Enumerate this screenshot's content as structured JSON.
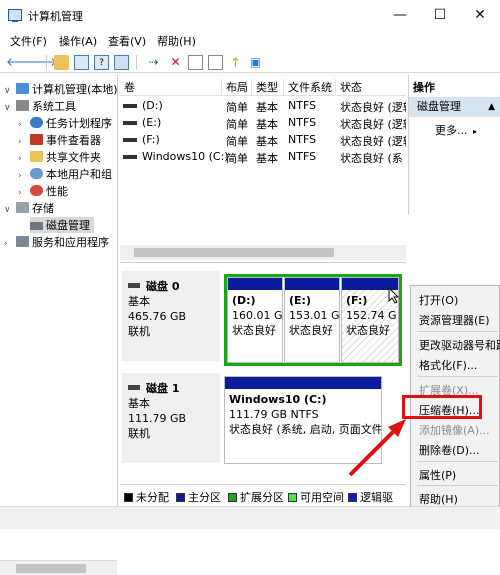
{
  "window": {
    "title": "计算机管理",
    "min": "—",
    "max": "☐",
    "close": "✕"
  },
  "menu": [
    "文件(F)",
    "操作(A)",
    "查看(V)",
    "帮助(H)"
  ],
  "toolbar": {
    "back": "🡐",
    "forward": "🡒",
    "icons": [
      "folder-icon",
      "properties-icon",
      "help-icon",
      "view-icon",
      "connect-icon",
      "delete-icon",
      "check-icon",
      "document-icon",
      "up-icon",
      "down-icon",
      "list-icon"
    ],
    "delete_glyph": "✕"
  },
  "tree": {
    "root": "计算机管理(本地)",
    "system_tools": "系统工具",
    "task_scheduler": "任务计划程序",
    "event_viewer": "事件查看器",
    "shared_folders": "共享文件夹",
    "local_users": "本地用户和组",
    "performance": "性能",
    "storage": "存储",
    "disk_management": "磁盘管理",
    "services": "服务和应用程序"
  },
  "volume_table": {
    "headers": [
      "卷",
      "布局",
      "类型",
      "文件系统",
      "状态"
    ],
    "rows": [
      {
        "vol": "(D:)",
        "layout": "简单",
        "type": "基本",
        "fs": "NTFS",
        "status": "状态良好 (逻辑"
      },
      {
        "vol": "(E:)",
        "layout": "简单",
        "type": "基本",
        "fs": "NTFS",
        "status": "状态良好 (逻辑"
      },
      {
        "vol": "(F:)",
        "layout": "简单",
        "type": "基本",
        "fs": "NTFS",
        "status": "状态良好 (逻辑"
      },
      {
        "vol": "Windows10 (C:)",
        "layout": "简单",
        "type": "基本",
        "fs": "NTFS",
        "status": "状态良好 (系"
      }
    ]
  },
  "disks": [
    {
      "name": "磁盘 0",
      "type": "基本",
      "size": "465.76 GB",
      "state": "联机",
      "parts": [
        {
          "label": "(D:)",
          "size": "160.01 G",
          "status": "状态良好"
        },
        {
          "label": "(E:)",
          "size": "153.01 G",
          "status": "状态良好"
        },
        {
          "label": "(F:)",
          "size": "152.74 G",
          "status": "状态良好"
        }
      ]
    },
    {
      "name": "磁盘 1",
      "type": "基本",
      "size": "111.79 GB",
      "state": "联机",
      "parts": [
        {
          "label": "Windows10 (C:)",
          "size": "111.79 GB NTFS",
          "status": "状态良好 (系统, 启动, 页面文件"
        }
      ]
    }
  ],
  "legend": [
    {
      "label": "未分配",
      "color": "#000000"
    },
    {
      "label": "主分区",
      "color": "#0a1b9c"
    },
    {
      "label": "扩展分区",
      "color": "#1aa61a"
    },
    {
      "label": "可用空间",
      "color": "#4be24b"
    },
    {
      "label": "逻辑驱",
      "color": "#0b20c4"
    }
  ],
  "actions": {
    "header": "操作",
    "section": "磁盘管理",
    "more": "更多..."
  },
  "context_menu": [
    {
      "label": "打开(O)",
      "enabled": true
    },
    {
      "label": "资源管理器(E)",
      "enabled": true
    },
    {
      "label": "更改驱动器号和路",
      "enabled": true
    },
    {
      "label": "格式化(F)...",
      "enabled": true
    },
    {
      "label": "扩展卷(X)...",
      "enabled": false
    },
    {
      "label": "压缩卷(H)...",
      "enabled": true
    },
    {
      "label": "添加镜像(A)...",
      "enabled": false
    },
    {
      "label": "删除卷(D)...",
      "enabled": true
    },
    {
      "label": "属性(P)",
      "enabled": true
    },
    {
      "label": "帮助(H)",
      "enabled": true
    }
  ],
  "colors": {
    "primary": "#0a1b9c",
    "extended": "#1aa61a",
    "highlight": "#e01010",
    "selected": "#d6e3f1"
  }
}
